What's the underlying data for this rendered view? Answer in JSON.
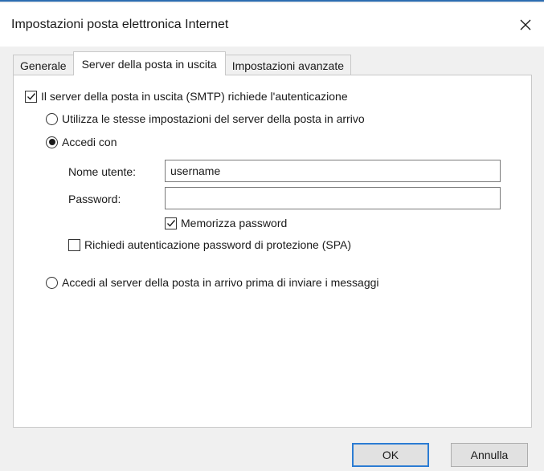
{
  "window": {
    "title": "Impostazioni posta elettronica Internet"
  },
  "tabs": [
    {
      "label": "Generale",
      "active": false
    },
    {
      "label": "Server della posta in uscita",
      "active": true
    },
    {
      "label": "Impostazioni avanzate",
      "active": false
    }
  ],
  "outgoing": {
    "smtp_auth_label": "Il server della posta in uscita (SMTP) richiede l'autenticazione",
    "smtp_auth_checked": true,
    "use_same_label": "Utilizza le stesse impostazioni del server della posta in arrivo",
    "use_same_selected": false,
    "login_with_label": "Accedi con",
    "login_with_selected": true,
    "username_label": "Nome utente:",
    "username_value": "username",
    "password_label": "Password:",
    "password_value": "",
    "remember_password_label": "Memorizza password",
    "remember_password_checked": true,
    "spa_label": "Richiedi autenticazione password di protezione (SPA)",
    "spa_checked": false,
    "login_incoming_first_label": "Accedi al server della posta in arrivo prima di inviare i messaggi",
    "login_incoming_first_selected": false
  },
  "buttons": {
    "ok": "OK",
    "cancel": "Annulla"
  },
  "icons": {
    "close": "close-icon",
    "check": "checkmark-icon"
  },
  "colors": {
    "accent": "#2b7cd3",
    "window_border": "#2b6cb0"
  }
}
